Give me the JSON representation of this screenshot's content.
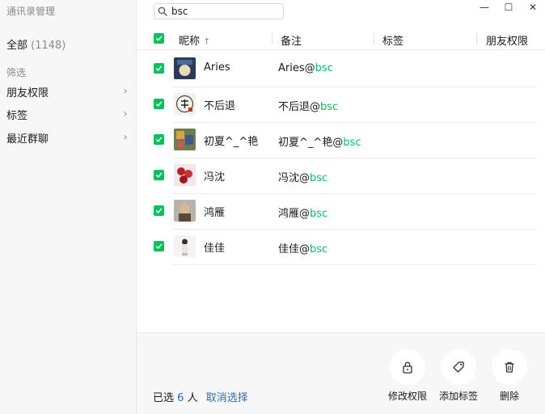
{
  "app": {
    "title": "通讯录管理"
  },
  "sidebar": {
    "all_label": "全部",
    "all_count": "(1148)",
    "filter_label": "筛选",
    "items": [
      {
        "label": "朋友权限"
      },
      {
        "label": "标签"
      },
      {
        "label": "最近群聊"
      }
    ]
  },
  "search": {
    "value": "bsc",
    "placeholder": ""
  },
  "window": {
    "minimize": "—",
    "maximize": "☐",
    "close": "✕"
  },
  "table": {
    "columns": [
      {
        "label": "昵称",
        "sort": "↑"
      },
      {
        "label": "备注"
      },
      {
        "label": "标签"
      },
      {
        "label": "朋友权限"
      }
    ],
    "rows": [
      {
        "nickname": "Aries",
        "remark_prefix": "Aries@",
        "remark_match": "bsc"
      },
      {
        "nickname": "不后退",
        "remark_prefix": "不后退@",
        "remark_match": "bsc"
      },
      {
        "nickname": "初夏^_^艳",
        "remark_prefix": "初夏^_^艳@",
        "remark_match": "bsc"
      },
      {
        "nickname": "冯沈",
        "remark_prefix": "冯沈@",
        "remark_match": "bsc"
      },
      {
        "nickname": "鸿雁",
        "remark_prefix": "鸿雁@",
        "remark_match": "bsc"
      },
      {
        "nickname": "佳佳",
        "remark_prefix": "佳佳@",
        "remark_match": "bsc"
      }
    ]
  },
  "footer": {
    "selected_prefix": "已选",
    "selected_count": "6",
    "selected_suffix": "人",
    "cancel_label": "取消选择",
    "actions": [
      {
        "label": "修改权限",
        "icon": "lock-icon"
      },
      {
        "label": "添加标签",
        "icon": "tag-icon"
      },
      {
        "label": "删除",
        "icon": "trash-icon"
      }
    ]
  },
  "colors": {
    "accent": "#07c160",
    "link": "#2f6fb3",
    "count": "#1a6cd8"
  }
}
